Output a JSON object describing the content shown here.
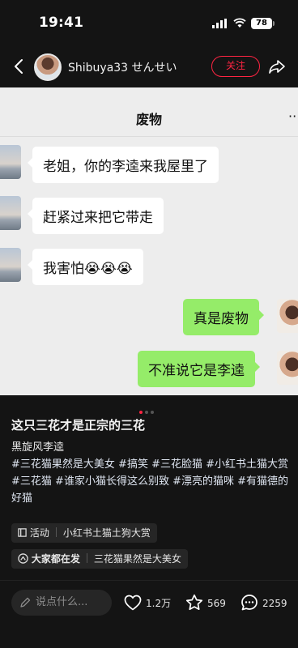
{
  "status_bar": {
    "time": "19:41",
    "battery": "78"
  },
  "header": {
    "author_name": "Shibuya33 せんせい",
    "follow_label": "关注"
  },
  "chat_image": {
    "title": "废物",
    "more": "··",
    "messages": [
      {
        "side": "left",
        "text": "老姐，你的李逵来我屋里了"
      },
      {
        "side": "left",
        "text": "赶紧过来把它带走"
      },
      {
        "side": "left",
        "text": "我害怕😭😭😭"
      },
      {
        "side": "right",
        "text": "真是废物"
      },
      {
        "side": "right",
        "text": "不准说它是李逵"
      }
    ]
  },
  "post": {
    "title": "这只三花才是正宗的三花",
    "line1": "黑旋风李逵",
    "tags": [
      "#三花猫果然是大美女",
      "#搞笑",
      "#三花脸猫",
      "#小红书土猫大赏",
      "#三花猫",
      "#谁家小猫长得这么别致",
      "#漂亮的猫咪",
      "#有猫德的好猫"
    ],
    "activity_label": "活动",
    "activity_text": "小红书土猫土狗大赏",
    "trending_label": "大家都在发",
    "trending_text": "三花猫果然是大美女"
  },
  "bottom_bar": {
    "comment_placeholder": "说点什么...",
    "likes": "1.2万",
    "collects": "569",
    "comments": "2259"
  },
  "colors": {
    "accent": "#ff2442",
    "bubble_right": "#95ec69",
    "chat_bg": "#ededed"
  }
}
